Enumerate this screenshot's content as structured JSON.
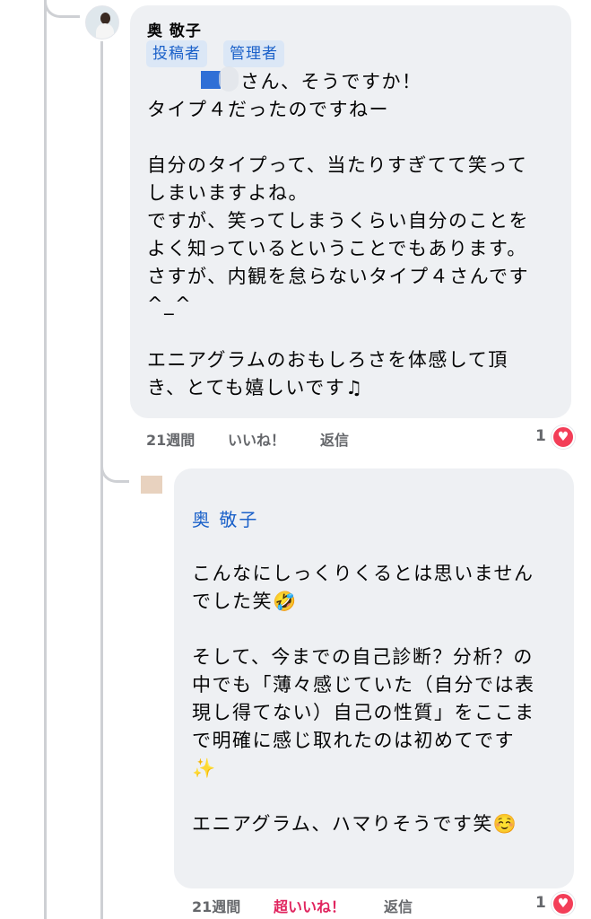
{
  "comment": {
    "author": "奥 敬子",
    "badges": [
      "投稿者",
      "管理者"
    ],
    "mention_suffix": "さん、そうですか！",
    "text": "タイプ４だったのですねー\n\n自分のタイプって、当たりすぎてて笑って\nしまいますよね。\nですが、笑ってしまうくらい自分のことを\nよく知っているということでもあります。\nさすが、内観を怠らないタイプ４さんです\n^_^\n\nエニアグラムのおもしろさを体感して頂\nき、とても嬉しいです♫",
    "time": "21週間",
    "like_label": "いいね！",
    "reply_label": "返信",
    "reaction_count": "1",
    "reaction_icon": "heart-icon"
  },
  "reply": {
    "mention": "奥 敬子",
    "text": "こんなにしっくりくるとは思いません\nでした笑🤣\n\nそして、今までの自己診断？分析？の\n中でも「薄々感じていた（自分では表\n現し得てない）自己の性質」をここま\nで明確に感じ取れたのは初めてです\n✨\n\nエニアグラム、ハマりそうです笑☺️",
    "time": "21週間",
    "like_label": "超いいね！",
    "reply_label": "返信",
    "reaction_count": "1",
    "reaction_icon": "heart-icon"
  },
  "colors": {
    "bubble": "#eef0f3",
    "link": "#1b61c9",
    "love": "#e0245e",
    "heart": "#f33e58"
  }
}
